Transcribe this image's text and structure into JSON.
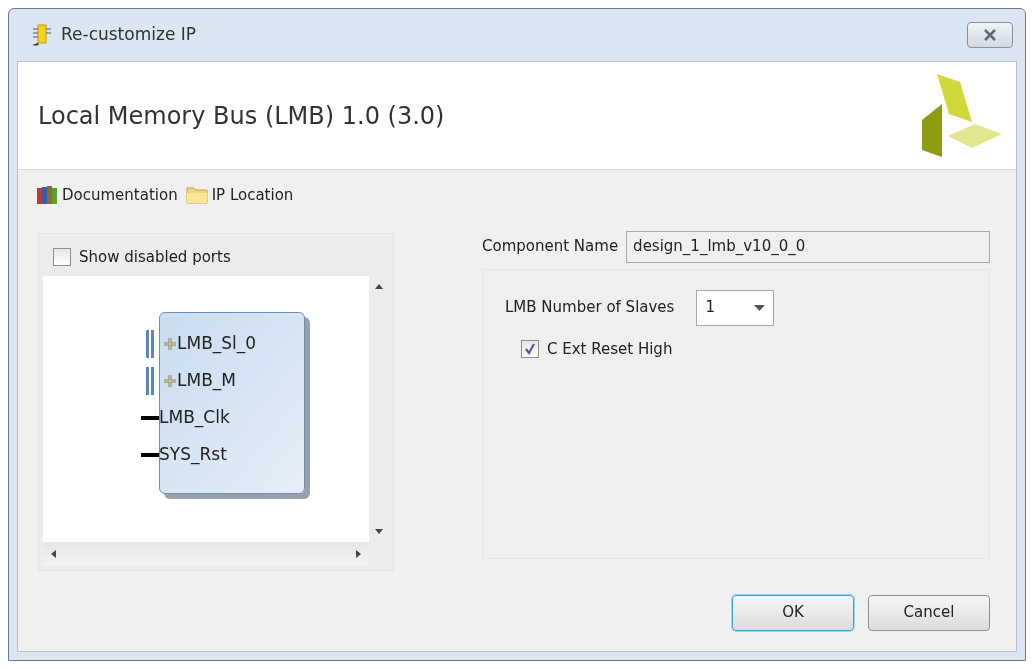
{
  "window": {
    "title": "Re-customize IP"
  },
  "header": {
    "title": "Local Memory Bus (LMB) 1.0 (3.0)"
  },
  "toolbar": [
    {
      "label": "Documentation",
      "kind": "book"
    },
    {
      "label": "IP Location",
      "kind": "folder"
    }
  ],
  "left_panel": {
    "show_disabled_ports": {
      "label": "Show disabled ports",
      "checked": false
    },
    "ports": [
      {
        "name": "LMB_Sl_0",
        "kind": "bus"
      },
      {
        "name": "LMB_M",
        "kind": "bus"
      },
      {
        "name": "LMB_Clk",
        "kind": "wire"
      },
      {
        "name": "SYS_Rst",
        "kind": "wire"
      }
    ]
  },
  "component_name": {
    "label": "Component Name",
    "value": "design_1_lmb_v10_0_0"
  },
  "slaves": {
    "label": "LMB Number of Slaves",
    "value": "1"
  },
  "ext_reset": {
    "label": "C Ext Reset High",
    "checked": true
  },
  "buttons": [
    {
      "label": "OK",
      "default": true
    },
    {
      "label": "Cancel",
      "default": false
    }
  ]
}
